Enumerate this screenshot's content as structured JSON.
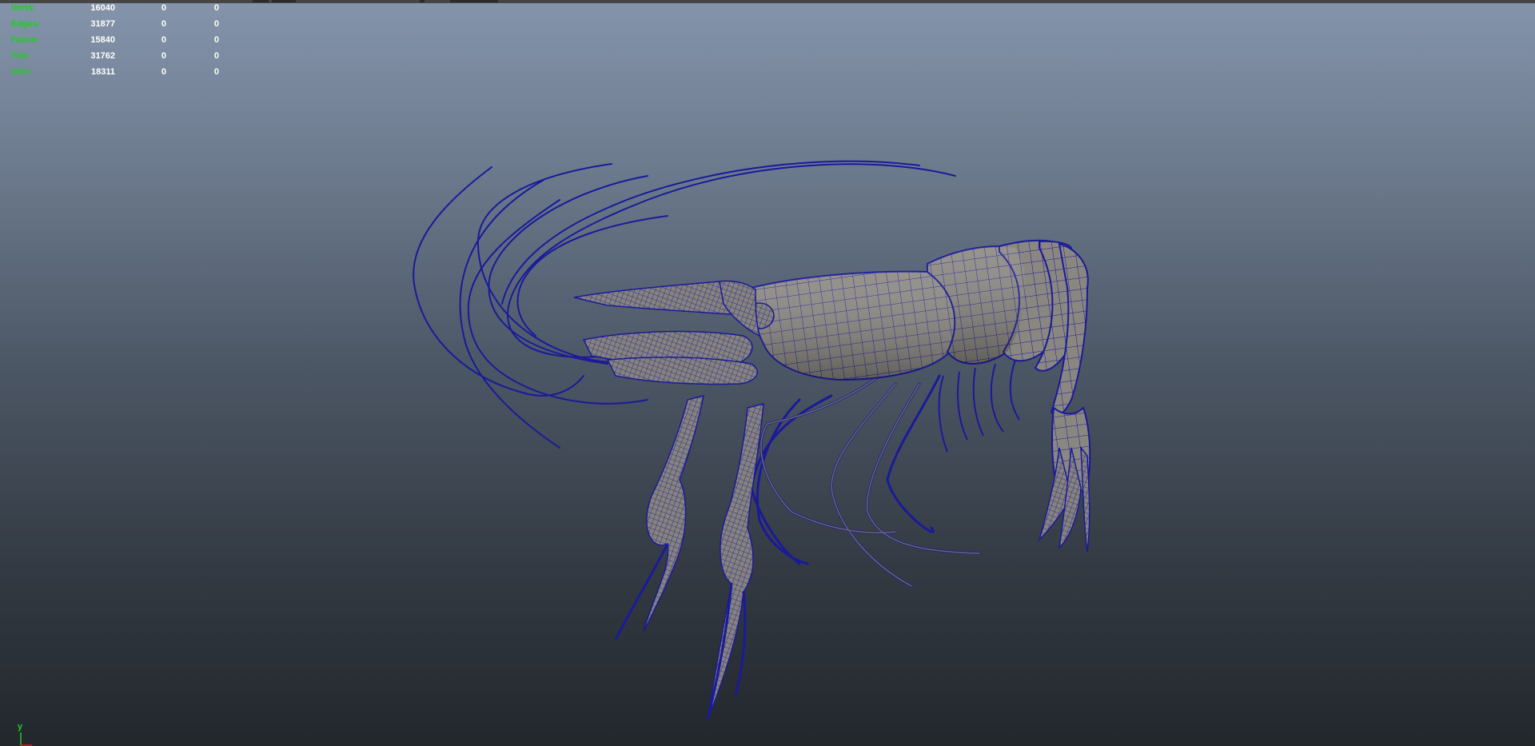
{
  "hud": {
    "rows": [
      {
        "label": "Verts:",
        "values": [
          "16040",
          "0",
          "0"
        ]
      },
      {
        "label": "Edges:",
        "values": [
          "31877",
          "0",
          "0"
        ]
      },
      {
        "label": "Faces:",
        "values": [
          "15840",
          "0",
          "0"
        ]
      },
      {
        "label": "Tris:",
        "values": [
          "31762",
          "0",
          "0"
        ]
      },
      {
        "label": "UVs:",
        "values": [
          "18311",
          "0",
          "0"
        ]
      }
    ]
  },
  "axis": {
    "label": "y"
  },
  "colors": {
    "wireframe": "#1a1a9a",
    "shaded": "#8a8780",
    "hud_label": "#1ad01a",
    "hud_value": "#ffffff"
  },
  "model": {
    "icon": "shrimp-mesh"
  }
}
